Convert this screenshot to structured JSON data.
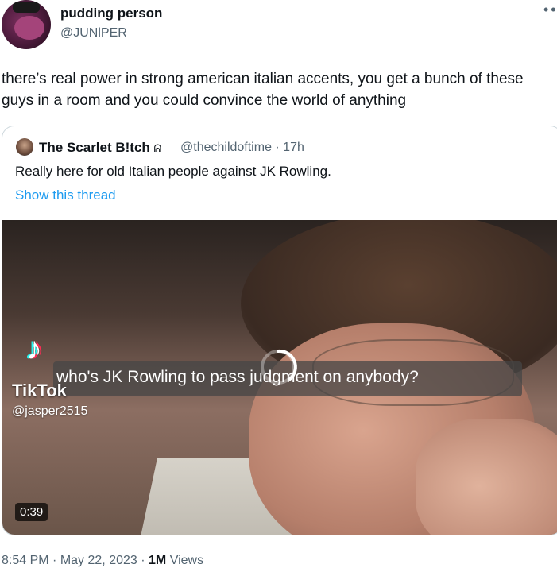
{
  "tweet": {
    "display_name": "pudding person",
    "handle": "@JUNlPER",
    "more_icon": "more-dots-icon",
    "text": "there’s real power in strong american italian accents, you get a bunch of these guys in a room and you could convince the world of anything"
  },
  "quote": {
    "display_name": "The Scarlet B!tch",
    "name_glyph": "ᕱ",
    "handle": "@thechildoftime · 17h",
    "text": "Really here for old Italian people against JK Rowling.",
    "show_thread": "Show this thread",
    "video": {
      "caption": "who's JK Rowling to pass judgment on anybody?",
      "tiktok_brand": "TikTok",
      "tiktok_handle": "@jasper2515",
      "duration": "0:39"
    }
  },
  "meta": {
    "time": "8:54 PM",
    "date": "May 22, 2023",
    "views_count": "1M",
    "views_label": "Views"
  },
  "colors": {
    "accent": "#1d9bf0",
    "secondary_text": "#536471",
    "border": "#cfd9de"
  }
}
